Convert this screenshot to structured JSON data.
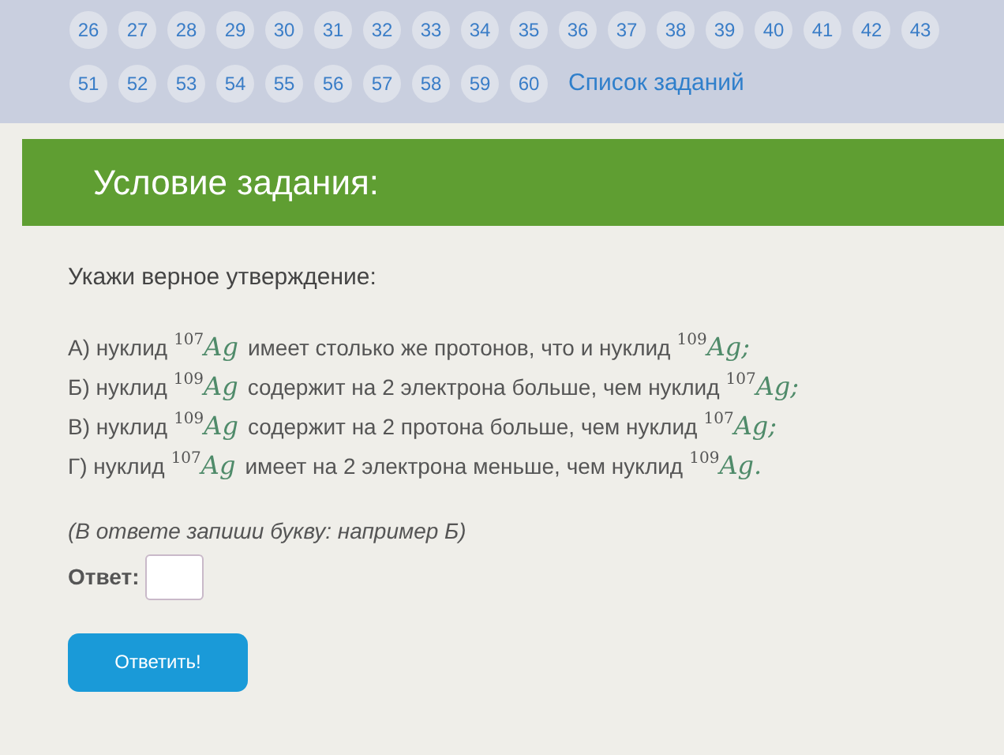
{
  "pagination": {
    "rows": [
      {
        "pages": [
          "26",
          "27",
          "28",
          "29",
          "30",
          "31",
          "32",
          "33",
          "34",
          "35",
          "36",
          "37",
          "38",
          "39",
          "40",
          "41",
          "42",
          "43"
        ]
      },
      {
        "pages": [
          "51",
          "52",
          "53",
          "54",
          "55",
          "56",
          "57",
          "58",
          "59",
          "60"
        ],
        "link": "Список заданий"
      }
    ]
  },
  "header": {
    "title": "Условие задания:"
  },
  "question": "Укажи верное утверждение:",
  "statements": [
    {
      "label": "А) нуклид",
      "nuclide_1": {
        "mass": "107",
        "symbol": "Ag"
      },
      "text": "имеет столько же протонов, что и нуклид",
      "nuclide_2": {
        "mass": "109",
        "symbol": "Ag;"
      }
    },
    {
      "label": "Б) нуклид",
      "nuclide_1": {
        "mass": "109",
        "symbol": "Ag"
      },
      "text": "содержит на 2 электрона больше, чем нуклид",
      "nuclide_2": {
        "mass": "107",
        "symbol": "Ag;"
      }
    },
    {
      "label": "В) нуклид",
      "nuclide_1": {
        "mass": "109",
        "symbol": "Ag"
      },
      "text": "содержит на 2 протона больше, чем нуклид",
      "nuclide_2": {
        "mass": "107",
        "symbol": "Ag;"
      }
    },
    {
      "label": "Г) нуклид",
      "nuclide_1": {
        "mass": "107",
        "symbol": "Ag"
      },
      "text": "имеет на 2 электрона меньше, чем нуклид",
      "nuclide_2": {
        "mass": "109",
        "symbol": "Ag."
      }
    }
  ],
  "hint": "(В ответе запиши букву: например Б)",
  "answer": {
    "label": "Ответ:"
  },
  "submit_button": "Ответить!"
}
